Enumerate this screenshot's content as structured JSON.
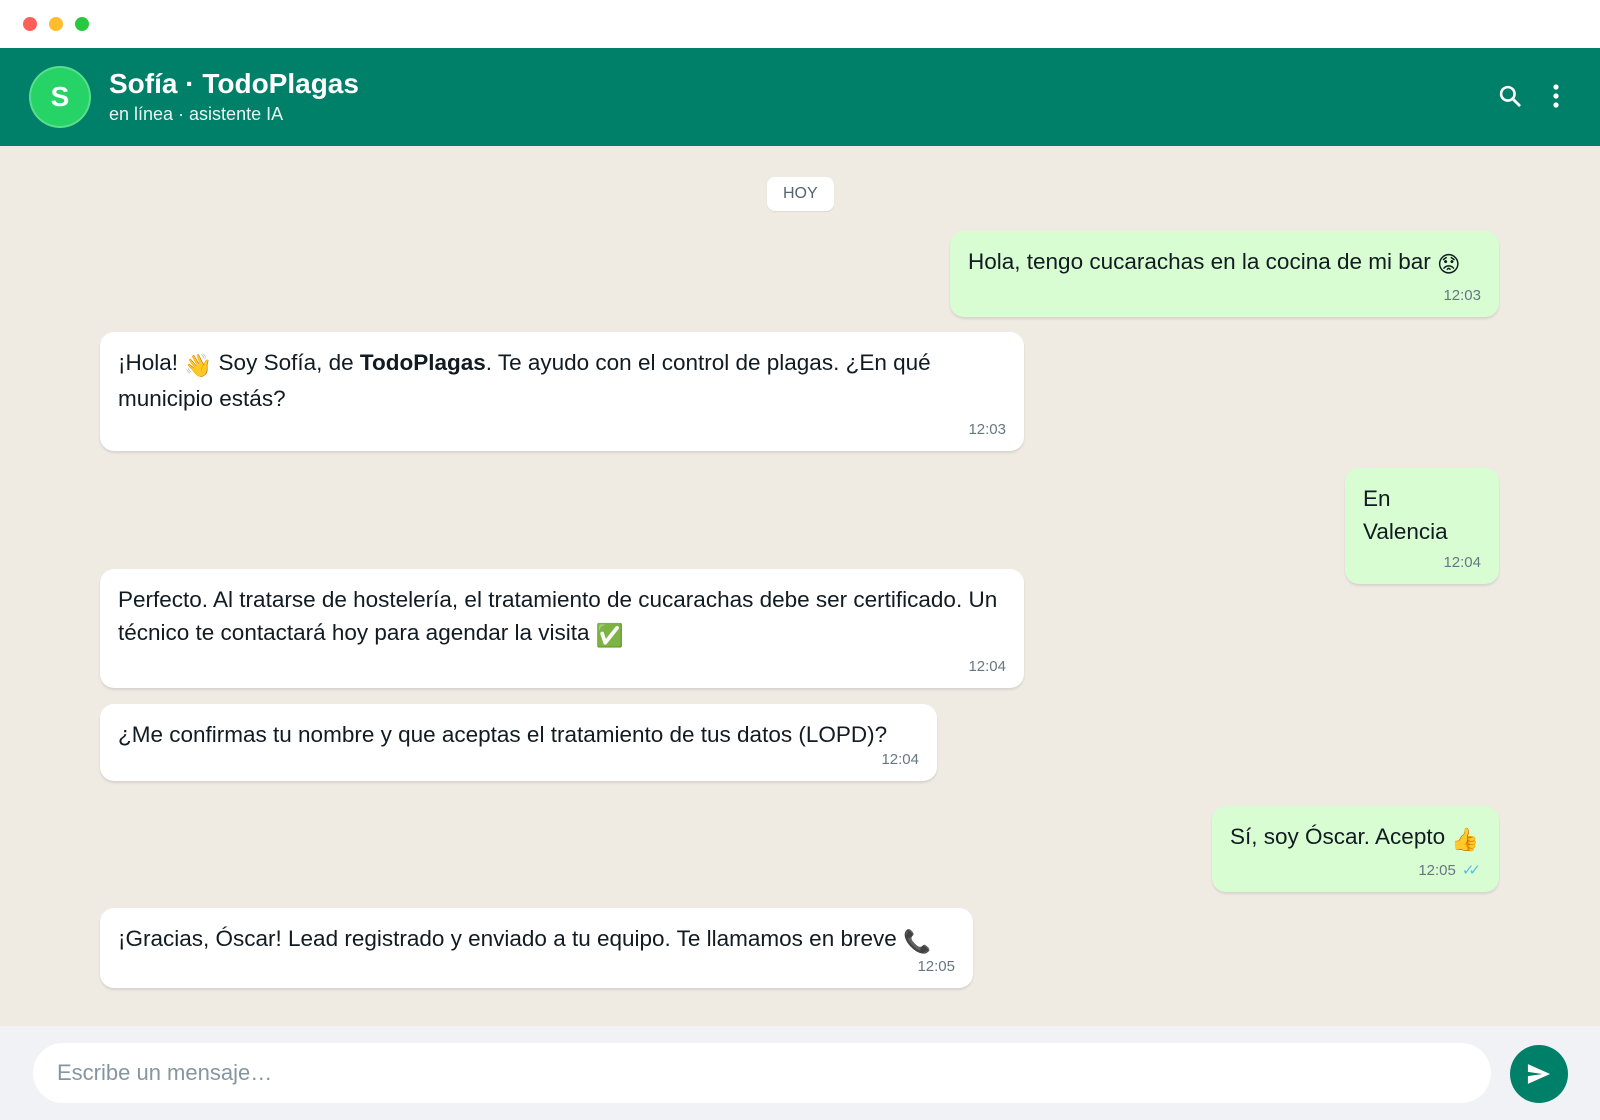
{
  "window": {
    "controls": [
      "close",
      "minimize",
      "maximize"
    ]
  },
  "header": {
    "avatar_initial": "S",
    "contact_name": "Sofía · TodoPlagas",
    "status": "en línea · asistente IA",
    "icons": [
      "search-icon",
      "more-vert-icon"
    ]
  },
  "chat": {
    "day_label": "HOY",
    "messages": [
      {
        "direction": "out",
        "text": "Hola, tengo cucarachas en la cocina de mi bar",
        "emoji": "😟",
        "time": "12:03"
      },
      {
        "direction": "in",
        "text_before": "¡Hola! ",
        "emoji": "👋",
        "text_mid": " Soy Sofía, de ",
        "bold": "TodoPlagas",
        "text_after": ". Te ayudo con el control de plagas. ¿En qué municipio estás?",
        "time": "12:03"
      },
      {
        "direction": "out",
        "text": "En Valencia",
        "time": "12:04"
      },
      {
        "direction": "in",
        "text": "Perfecto. Al tratarse de hostelería, el tratamiento de cucarachas debe ser certificado. Un técnico te contactará hoy para agendar la visita",
        "emoji": "✅",
        "time": "12:04"
      },
      {
        "direction": "in",
        "text": "¿Me confirmas tu nombre y que aceptas el tratamiento de tus datos (LOPD)?",
        "time": "12:04"
      },
      {
        "direction": "out",
        "text": "Sí, soy Óscar. Acepto",
        "emoji": "👍",
        "time": "12:05",
        "status": "read"
      },
      {
        "direction": "in",
        "text": "¡Gracias, Óscar! Lead registrado y enviado a tu equipo. Te llamamos en breve",
        "emoji": "📞",
        "time": "12:05"
      }
    ]
  },
  "composer": {
    "placeholder": "Escribe un mensaje…",
    "value": "",
    "send_icon": "send-icon"
  },
  "colors": {
    "header": "#008069",
    "avatar": "#25d366",
    "chat_background": "#efeae2",
    "outgoing_bubble": "#d9fdd3",
    "incoming_bubble": "#ffffff",
    "read_ticks": "#53bdeb"
  }
}
